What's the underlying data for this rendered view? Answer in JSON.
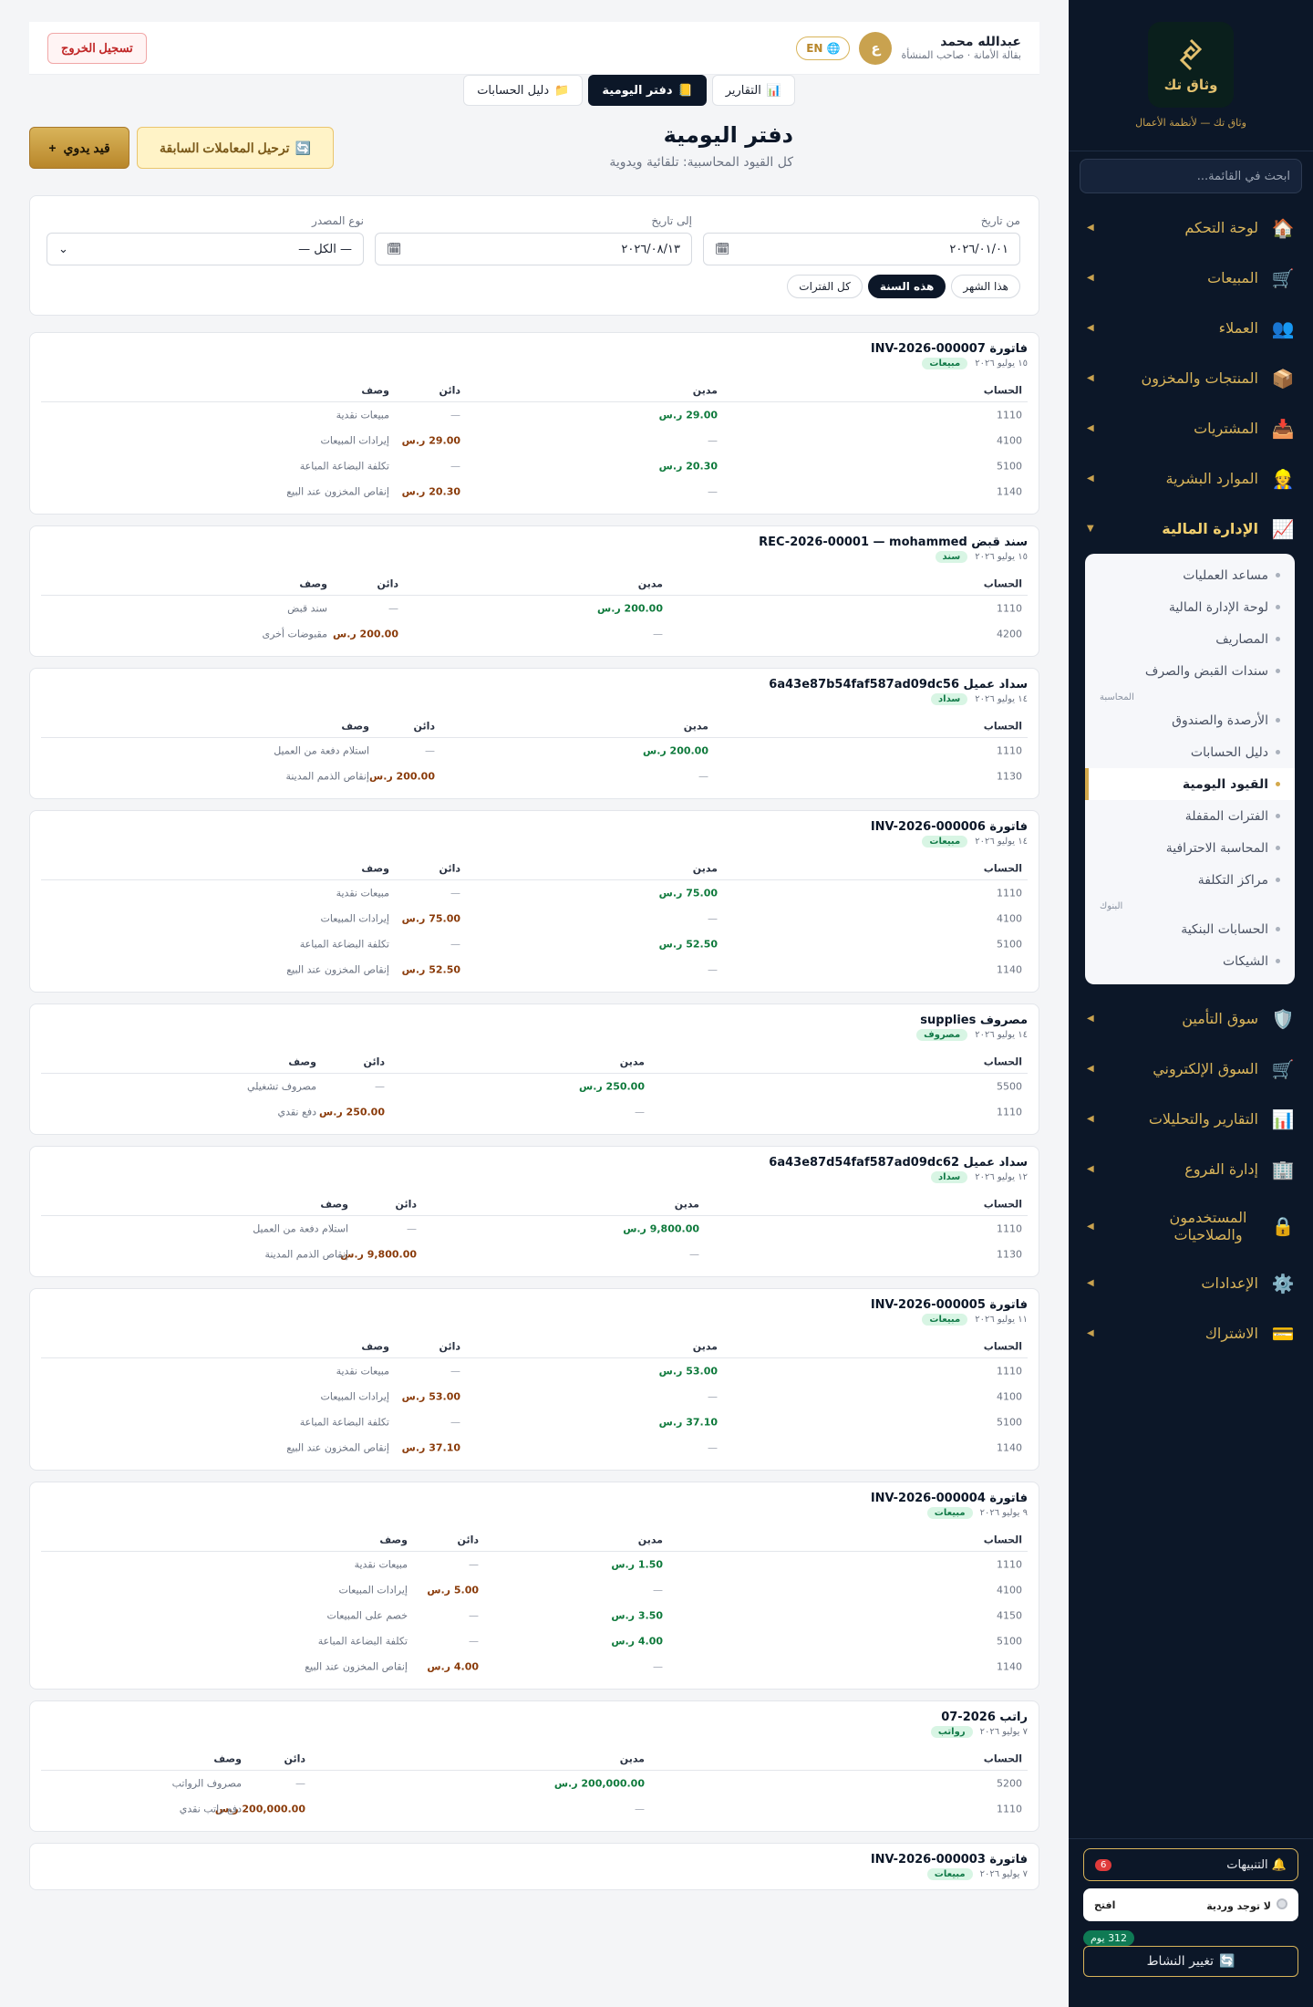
{
  "sidebar": {
    "brand": "وثاق تك",
    "tagline": "وثاق تك — لأنظمة الأعمال",
    "search_placeholder": "ابحث في القائمة...",
    "items": [
      {
        "icon": "🏠",
        "label": "لوحة التحكم"
      },
      {
        "icon": "🛒",
        "label": "المبيعات"
      },
      {
        "icon": "👥",
        "label": "العملاء"
      },
      {
        "icon": "📦",
        "label": "المنتجات والمخزون"
      },
      {
        "icon": "📥",
        "label": "المشتريات"
      },
      {
        "icon": "👷",
        "label": "الموارد البشرية"
      },
      {
        "icon": "📈",
        "label": "الإدارة المالية"
      }
    ],
    "finance_submenu": [
      {
        "label": "مساعد العمليات"
      },
      {
        "label": "لوحة الإدارة المالية"
      },
      {
        "label": "المصاريف"
      },
      {
        "label": "سندات القبض والصرف"
      }
    ],
    "group_accounting": "المحاسبة",
    "accounting_items": [
      {
        "label": "الأرصدة والصندوق"
      },
      {
        "label": "دليل الحسابات"
      },
      {
        "label": "القيود اليومية"
      },
      {
        "label": "الفترات المقفلة"
      },
      {
        "label": "المحاسبة الاحترافية"
      },
      {
        "label": "مراكز التكلفة"
      }
    ],
    "group_banks": "البنوك",
    "bank_items": [
      {
        "label": "الحسابات البنكية"
      },
      {
        "label": "الشيكات"
      }
    ],
    "items_after": [
      {
        "icon": "🛡️",
        "label": "سوق التأمين"
      },
      {
        "icon": "🛒",
        "label": "السوق الإلكتروني"
      },
      {
        "icon": "📊",
        "label": "التقارير والتحليلات"
      },
      {
        "icon": "🏢",
        "label": "إدارة الفروع"
      },
      {
        "icon": "🔒",
        "label": "المستخدمون والصلاحيات"
      },
      {
        "icon": "⚙️",
        "label": "الإعدادات"
      },
      {
        "icon": "💳",
        "label": "الاشتراك"
      }
    ],
    "notifications_label": "التنبيهات",
    "notifications_count": "6",
    "shift_status": "لا توجد وردية",
    "shift_open": "افتح",
    "days_badge": "312 يوم",
    "activity_label": "تغيير النشاط"
  },
  "topbar": {
    "user_name": "عبدالله محمد",
    "user_role": "بقالة الأمانة · صاحب المنشأة",
    "avatar_letter": "ع",
    "lang": "EN",
    "logout": "تسجيل الخروج"
  },
  "tabs": [
    {
      "icon": "📊",
      "label": "التقارير"
    },
    {
      "icon": "📒",
      "label": "دفتر اليومية"
    },
    {
      "icon": "📁",
      "label": "دليل الحسابات"
    }
  ],
  "page": {
    "title": "دفتر اليومية",
    "subtitle": "كل القيود المحاسبية: تلقائية ويدوية",
    "manual_btn": "قيد يدوي",
    "manual_icon": "+",
    "migrate_btn": "ترحيل المعاملات السابقة",
    "migrate_icon": "🔄"
  },
  "filters": {
    "from_label": "من تاريخ",
    "from_value": "٢٠٢٦/٠١/٠١",
    "to_label": "إلى تاريخ",
    "to_value": "٢٠٢٦/٠٨/١٣",
    "source_label": "نوع المصدر",
    "source_value": "— الكل —",
    "chips": [
      "هذا الشهر",
      "هذه السنة",
      "كل الفترات"
    ]
  },
  "table_headers": {
    "account": "الحساب",
    "debit": "مدين",
    "credit": "دائن",
    "desc": "وصف"
  },
  "entries": [
    {
      "title": "فاتورة INV-2026-000007",
      "date": "١٥ يوليو ٢٠٢٦",
      "badge": "مبيعات",
      "rows": [
        {
          "acct": "1110",
          "debit": "29.00 ر.س",
          "credit": "—",
          "desc": "مبيعات نقدية"
        },
        {
          "acct": "4100",
          "debit": "—",
          "credit": "29.00 ر.س",
          "desc": "إيرادات المبيعات"
        },
        {
          "acct": "5100",
          "debit": "20.30 ر.س",
          "credit": "—",
          "desc": "تكلفة البضاعة المباعة"
        },
        {
          "acct": "1140",
          "debit": "—",
          "credit": "20.30 ر.س",
          "desc": "إنقاص المخزون عند البيع"
        }
      ]
    },
    {
      "title": "سند قبض REC-2026-00001 — mohammed",
      "date": "١٥ يوليو ٢٠٢٦",
      "badge": "سند",
      "rows": [
        {
          "acct": "1110",
          "debit": "200.00 ر.س",
          "credit": "—",
          "desc": "سند قبض"
        },
        {
          "acct": "4200",
          "debit": "—",
          "credit": "200.00 ر.س",
          "desc": "مقبوضات أخرى"
        }
      ]
    },
    {
      "title": "سداد عميل 6a43e87b54faf587ad09dc56",
      "date": "١٤ يوليو ٢٠٢٦",
      "badge": "سداد",
      "rows": [
        {
          "acct": "1110",
          "debit": "200.00 ر.س",
          "credit": "—",
          "desc": "استلام دفعة من العميل"
        },
        {
          "acct": "1130",
          "debit": "—",
          "credit": "200.00 ر.س",
          "desc": "إنقاص الذمم المدينة"
        }
      ]
    },
    {
      "title": "فاتورة INV-2026-000006",
      "date": "١٤ يوليو ٢٠٢٦",
      "badge": "مبيعات",
      "rows": [
        {
          "acct": "1110",
          "debit": "75.00 ر.س",
          "credit": "—",
          "desc": "مبيعات نقدية"
        },
        {
          "acct": "4100",
          "debit": "—",
          "credit": "75.00 ر.س",
          "desc": "إيرادات المبيعات"
        },
        {
          "acct": "5100",
          "debit": "52.50 ر.س",
          "credit": "—",
          "desc": "تكلفة البضاعة المباعة"
        },
        {
          "acct": "1140",
          "debit": "—",
          "credit": "52.50 ر.س",
          "desc": "إنقاص المخزون عند البيع"
        }
      ]
    },
    {
      "title": "مصروف supplies",
      "date": "١٤ يوليو ٢٠٢٦",
      "badge": "مصروف",
      "rows": [
        {
          "acct": "5500",
          "debit": "250.00 ر.س",
          "credit": "—",
          "desc": "مصروف تشغيلي"
        },
        {
          "acct": "1110",
          "debit": "—",
          "credit": "250.00 ر.س",
          "desc": "دفع نقدي"
        }
      ]
    },
    {
      "title": "سداد عميل 6a43e87d54faf587ad09dc62",
      "date": "١٢ يوليو ٢٠٢٦",
      "badge": "سداد",
      "rows": [
        {
          "acct": "1110",
          "debit": "9,800.00 ر.س",
          "credit": "—",
          "desc": "استلام دفعة من العميل"
        },
        {
          "acct": "1130",
          "debit": "—",
          "credit": "9,800.00 ر.س",
          "desc": "إنقاص الذمم المدينة"
        }
      ]
    },
    {
      "title": "فاتورة INV-2026-000005",
      "date": "١١ يوليو ٢٠٢٦",
      "badge": "مبيعات",
      "rows": [
        {
          "acct": "1110",
          "debit": "53.00 ر.س",
          "credit": "—",
          "desc": "مبيعات نقدية"
        },
        {
          "acct": "4100",
          "debit": "—",
          "credit": "53.00 ر.س",
          "desc": "إيرادات المبيعات"
        },
        {
          "acct": "5100",
          "debit": "37.10 ر.س",
          "credit": "—",
          "desc": "تكلفة البضاعة المباعة"
        },
        {
          "acct": "1140",
          "debit": "—",
          "credit": "37.10 ر.س",
          "desc": "إنقاص المخزون عند البيع"
        }
      ]
    },
    {
      "title": "فاتورة INV-2026-000004",
      "date": "٩ يوليو ٢٠٢٦",
      "badge": "مبيعات",
      "rows": [
        {
          "acct": "1110",
          "debit": "1.50 ر.س",
          "credit": "—",
          "desc": "مبيعات نقدية"
        },
        {
          "acct": "4100",
          "debit": "—",
          "credit": "5.00 ر.س",
          "desc": "إيرادات المبيعات"
        },
        {
          "acct": "4150",
          "debit": "3.50 ر.س",
          "credit": "—",
          "desc": "خصم على المبيعات"
        },
        {
          "acct": "5100",
          "debit": "4.00 ر.س",
          "credit": "—",
          "desc": "تكلفة البضاعة المباعة"
        },
        {
          "acct": "1140",
          "debit": "—",
          "credit": "4.00 ر.س",
          "desc": "إنقاص المخزون عند البيع"
        }
      ]
    },
    {
      "title": "راتب 2026-07",
      "date": "٧ يوليو ٢٠٢٦",
      "badge": "رواتب",
      "rows": [
        {
          "acct": "5200",
          "debit": "200,000.00 ر.س",
          "credit": "—",
          "desc": "مصروف الرواتب"
        },
        {
          "acct": "1110",
          "debit": "—",
          "credit": "200,000.00 ر.س",
          "desc": "دفع راتب نقدي"
        }
      ]
    },
    {
      "title": "فاتورة INV-2026-000003",
      "date": "٧ يوليو ٢٠٢٦",
      "badge": "مبيعات",
      "rows": []
    }
  ]
}
